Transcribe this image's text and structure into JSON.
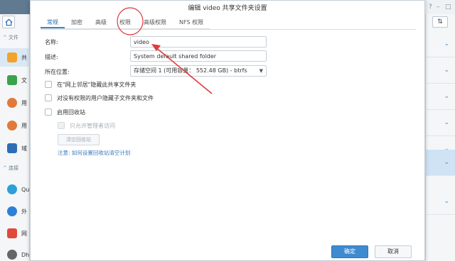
{
  "background": {
    "left_groups": [
      {
        "label": "文件"
      },
      {
        "label": "连接"
      }
    ],
    "left_items": [
      {
        "label": "共",
        "icon": "shared-folder-icon",
        "color": "#f2a32b"
      },
      {
        "label": "文",
        "icon": "file-services-icon",
        "color": "#3aa34a"
      },
      {
        "label": "用",
        "icon": "user-icon",
        "color": "#e07a3a"
      },
      {
        "label": "用",
        "icon": "group-icon",
        "color": "#e07a3a"
      },
      {
        "label": "域",
        "icon": "domain-icon",
        "color": "#2e6db5"
      },
      {
        "label": "Qu",
        "icon": "quickconnect-icon",
        "color": "#2e9fd8"
      },
      {
        "label": "外",
        "icon": "external-access-icon",
        "color": "#2e7fd8"
      },
      {
        "label": "网",
        "icon": "network-icon",
        "color": "#e04a3a"
      },
      {
        "label": "Dh",
        "icon": "dhcp-icon",
        "color": "#666666"
      }
    ],
    "sort_button": "⇅"
  },
  "dialog": {
    "title": "编辑 video 共享文件夹设置",
    "tabs": [
      {
        "label": "常规",
        "active": true
      },
      {
        "label": "加密",
        "active": false
      },
      {
        "label": "高级",
        "active": false
      },
      {
        "label": "权限",
        "active": false
      },
      {
        "label": "高级权限",
        "active": false
      },
      {
        "label": "NFS 权限",
        "active": false
      }
    ],
    "fields": {
      "name_label": "名称:",
      "name_value": "video",
      "desc_label": "描述:",
      "desc_value": "System default shared folder",
      "location_label": "所在位置:",
      "location_value": "存储空间 1 (可用容量： 552.48 GB) - btrfs"
    },
    "checkboxes": {
      "hide_network": "在\"网上邻居\"隐藏此共享文件夹",
      "hide_no_permission": "对没有权限的用户隐藏子文件夹和文件",
      "enable_recycle": "启用回收站",
      "admin_only": "只允许管理者访问"
    },
    "empty_recycle_button": "清空回收站",
    "note_label": "注意:",
    "note_link": "如何设置回收站清空计划",
    "ok_button": "确定",
    "cancel_button": "取消"
  },
  "colors": {
    "accent": "#3f8bd0",
    "annotation": "#e0393e"
  }
}
